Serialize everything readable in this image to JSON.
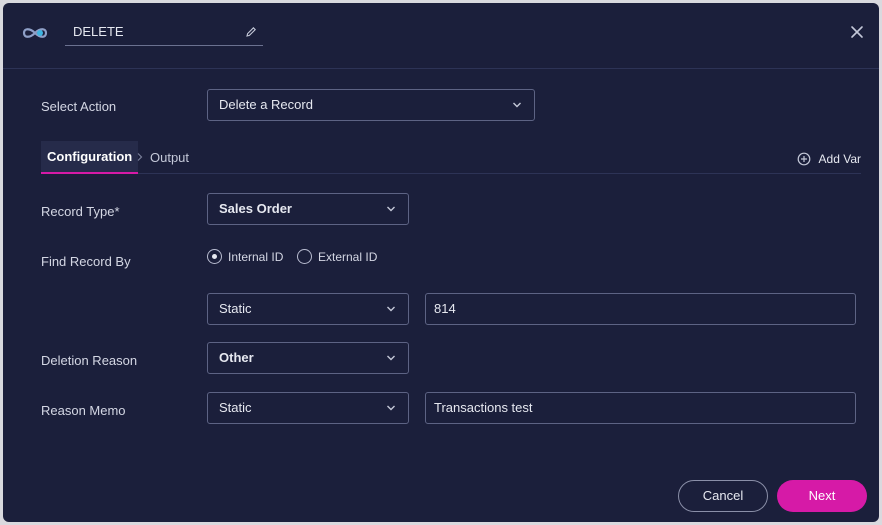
{
  "header": {
    "workflow_name": "DELETE",
    "logo_icon": "infinity-logo-icon",
    "edit_icon": "pencil-icon",
    "close_icon": "close-icon"
  },
  "select_action": {
    "label": "Select Action",
    "value": "Delete a Record"
  },
  "tabs": {
    "configuration": "Configuration",
    "output": "Output",
    "add_var": "Add Var"
  },
  "form": {
    "record_type": {
      "label": "Record Type*",
      "value": "Sales Order"
    },
    "find_record_by": {
      "label": "Find Record By",
      "options": [
        "Internal ID",
        "External ID"
      ],
      "selected": "Internal ID",
      "mode": "Static",
      "value": "814"
    },
    "deletion_reason": {
      "label": "Deletion Reason",
      "value": "Other"
    },
    "reason_memo": {
      "label": "Reason Memo",
      "mode": "Static",
      "value": "Transactions test"
    }
  },
  "footer": {
    "cancel": "Cancel",
    "next": "Next"
  },
  "colors": {
    "background": "#1b1f3b",
    "accent": "#d61aa7",
    "border": "#5d6384"
  }
}
